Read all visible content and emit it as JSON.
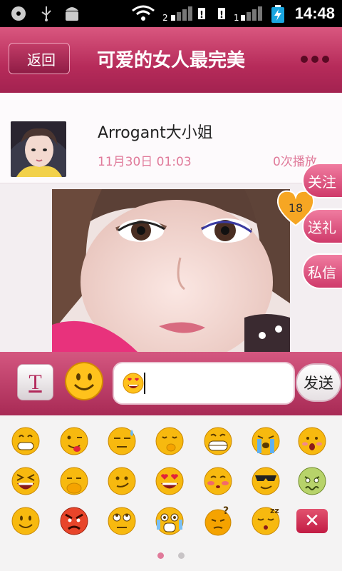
{
  "status_bar": {
    "time": "14:48",
    "sim1_label": "2",
    "sim2_label": "1"
  },
  "header": {
    "back_label": "返回",
    "title": "可爱的女人最完美"
  },
  "post": {
    "username": "Arrogant大小姐",
    "date": "11月30日  01:03",
    "play_count": "0次播放"
  },
  "actions": {
    "follow_label": "关注",
    "gift_label": "送礼",
    "message_label": "私信",
    "gift_count": "18"
  },
  "composer": {
    "text_icon_label": "T",
    "send_label": "发送"
  },
  "emoji_panel": {
    "rows": [
      [
        "grin",
        "tongue",
        "sweat",
        "shush",
        "big-grin",
        "cry",
        "shy"
      ],
      [
        "laugh-squint",
        "cold",
        "smirk",
        "heart-eyes",
        "blush",
        "cool",
        "sick"
      ],
      [
        "smile",
        "angry",
        "eye-roll",
        "shocked",
        "confused",
        "sleepy",
        "delete"
      ]
    ],
    "page_count": 2,
    "current_page": 1,
    "delete_label": "✕"
  },
  "colors": {
    "accent": "#b62b5a",
    "accent_light": "#e07a9a",
    "emoji_yellow": "#f7b90f"
  }
}
